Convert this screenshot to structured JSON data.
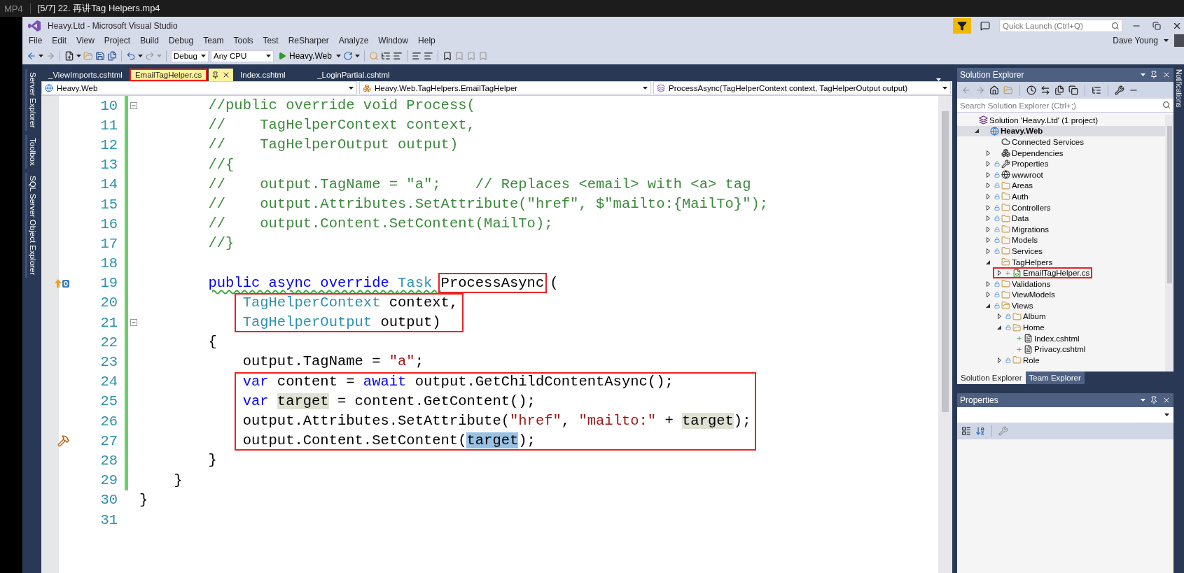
{
  "player": {
    "format": "MP4",
    "title": "[5/7] 22. 再讲Tag Helpers.mp4"
  },
  "window": {
    "title": "Heavy.Ltd - Microsoft Visual Studio",
    "quick_launch": {
      "placeholder": "Quick Launch (Ctrl+Q)"
    },
    "user": "Dave Young"
  },
  "menu": [
    "File",
    "Edit",
    "View",
    "Project",
    "Build",
    "Debug",
    "Team",
    "Tools",
    "Test",
    "ReSharper",
    "Analyze",
    "Window",
    "Help"
  ],
  "toolbar": {
    "configuration": "Debug",
    "platform": "Any CPU",
    "run": "Heavy.Web"
  },
  "left_tool_tabs": [
    "Server Explorer",
    "Toolbox",
    "SQL Server Object Explorer"
  ],
  "right_tool_tabs": [
    "Notifications"
  ],
  "editor": {
    "tabs": [
      {
        "label": "_ViewImports.cshtml",
        "selected": false,
        "boxed": false
      },
      {
        "label": "EmailTagHelper.cs",
        "selected": true,
        "boxed": true
      },
      {
        "label": "Index.cshtml",
        "selected": false,
        "boxed": false
      },
      {
        "label": "_LoginPartial.cshtml",
        "selected": false,
        "boxed": false
      }
    ],
    "navigation": [
      "Heavy.Web",
      "Heavy.Web.TagHelpers.EmailTagHelper",
      "ProcessAsync(TagHelperContext context, TagHelperOutput output)"
    ],
    "lines": [
      {
        "number": "10",
        "changed": true,
        "foldable": true,
        "tokens": [
          {
            "kind": "comment",
            "text": "        //public override void Process("
          }
        ]
      },
      {
        "number": "11",
        "changed": true,
        "tokens": [
          {
            "kind": "comment",
            "text": "        //    TagHelperContext context,"
          }
        ]
      },
      {
        "number": "12",
        "changed": true,
        "tokens": [
          {
            "kind": "comment",
            "text": "        //    TagHelperOutput output)"
          }
        ]
      },
      {
        "number": "13",
        "changed": true,
        "tokens": [
          {
            "kind": "comment",
            "text": "        //{"
          }
        ]
      },
      {
        "number": "14",
        "changed": true,
        "tokens": [
          {
            "kind": "comment",
            "text": "        //    output.TagName = \"a\";    // Replaces <email> with <a> tag"
          }
        ]
      },
      {
        "number": "15",
        "changed": true,
        "tokens": [
          {
            "kind": "comment",
            "text": "        //    output.Attributes.SetAttribute(\"href\", $\"mailto:{MailTo}\");"
          }
        ]
      },
      {
        "number": "16",
        "changed": true,
        "tokens": [
          {
            "kind": "comment",
            "text": "        //    output.Content.SetContent(MailTo);"
          }
        ]
      },
      {
        "number": "17",
        "changed": true,
        "tokens": [
          {
            "kind": "comment",
            "text": "        //}"
          }
        ]
      },
      {
        "number": "18",
        "changed": true
      },
      {
        "number": "19",
        "changed": true,
        "override_glyph": true,
        "tokens": [
          {
            "kind": "keyword",
            "text": "        public async override ",
            "warning": true
          },
          {
            "kind": "type",
            "text": "Task ",
            "warning": true
          },
          {
            "kind": "plain",
            "text": "ProcessAsync",
            "boxed": true
          },
          {
            "kind": "plain",
            "text": "("
          }
        ]
      },
      {
        "number": "20",
        "changed": true,
        "boxed": true,
        "tokens": [
          {
            "kind": "type",
            "text": "            TagHelperContext"
          },
          {
            "kind": "plain",
            "text": " context,"
          }
        ]
      },
      {
        "number": "21",
        "changed": true,
        "boxed": true,
        "foldable": true,
        "tokens": [
          {
            "kind": "type",
            "text": "            TagHelperOutput"
          },
          {
            "kind": "plain",
            "text": " output)"
          }
        ]
      },
      {
        "number": "22",
        "changed": true,
        "tokens": [
          {
            "kind": "plain",
            "text": "        {"
          }
        ]
      },
      {
        "number": "23",
        "changed": true,
        "tokens": [
          {
            "kind": "plain",
            "text": "            output.TagName = "
          },
          {
            "kind": "string",
            "text": "\"a\""
          },
          {
            "kind": "plain",
            "text": ";"
          }
        ]
      },
      {
        "number": "24",
        "changed": true,
        "boxed": true,
        "tokens": [
          {
            "kind": "keyword",
            "text": "            var"
          },
          {
            "kind": "plain",
            "text": " content = "
          },
          {
            "kind": "keyword",
            "text": "await"
          },
          {
            "kind": "plain",
            "text": " output.GetChildContentAsync();"
          }
        ]
      },
      {
        "number": "25",
        "changed": true,
        "boxed": true,
        "tokens": [
          {
            "kind": "keyword",
            "text": "            var "
          },
          {
            "kind": "reference",
            "text": "target"
          },
          {
            "kind": "plain",
            "text": " = content.GetContent();"
          }
        ]
      },
      {
        "number": "26",
        "changed": true,
        "boxed": true,
        "tokens": [
          {
            "kind": "plain",
            "text": "            output.Attributes.SetAttribute("
          },
          {
            "kind": "string",
            "text": "\"href\""
          },
          {
            "kind": "plain",
            "text": ", "
          },
          {
            "kind": "string",
            "text": "\"mailto:\""
          },
          {
            "kind": "plain",
            "text": " + "
          },
          {
            "kind": "reference",
            "text": "target"
          },
          {
            "kind": "plain",
            "text": ");"
          }
        ]
      },
      {
        "number": "27",
        "changed": true,
        "boxed": true,
        "build_glyph": true,
        "tokens": [
          {
            "kind": "plain",
            "text": "            output.Content.SetContent("
          },
          {
            "kind": "selection",
            "text": "target"
          },
          {
            "kind": "plain",
            "text": ");"
          }
        ]
      },
      {
        "number": "28",
        "changed": true,
        "tokens": [
          {
            "kind": "plain",
            "text": "        }"
          }
        ]
      },
      {
        "number": "29",
        "changed": true,
        "tokens": [
          {
            "kind": "plain",
            "text": "    }"
          }
        ]
      },
      {
        "number": "30",
        "changed": false,
        "tokens": [
          {
            "kind": "plain",
            "text": "}"
          }
        ]
      },
      {
        "number": "31",
        "changed": false
      }
    ]
  },
  "solution_explorer": {
    "title": "Solution Explorer",
    "search": {
      "placeholder": "Search Solution Explorer (Ctrl+;)"
    },
    "tree": [
      {
        "label": "Solution 'Heavy.Ltd' (1 project)",
        "kind": "solution",
        "checked_in": false,
        "added": false,
        "selected": false,
        "children": [
          {
            "label": "Heavy.Web",
            "kind": "project",
            "checked_in": false,
            "added": false,
            "selected": true,
            "expanded": true,
            "children": [
              {
                "label": "Connected Services",
                "kind": "cloud",
                "checked_in": false,
                "added": false,
                "selected": false
              },
              {
                "label": "Dependencies",
                "kind": "dependencies",
                "checked_in": false,
                "added": false,
                "selected": false,
                "expanded": false
              },
              {
                "label": "Properties",
                "kind": "properties",
                "checked_in": true,
                "added": false,
                "selected": false,
                "expanded": false
              },
              {
                "label": "wwwroot",
                "kind": "globe",
                "checked_in": true,
                "added": false,
                "selected": false,
                "expanded": false
              },
              {
                "label": "Areas",
                "kind": "folder",
                "checked_in": true,
                "added": false,
                "selected": false,
                "expanded": false
              },
              {
                "label": "Auth",
                "kind": "folder",
                "checked_in": true,
                "added": false,
                "selected": false,
                "expanded": false
              },
              {
                "label": "Controllers",
                "kind": "folder",
                "checked_in": true,
                "added": false,
                "selected": false,
                "expanded": false
              },
              {
                "label": "Data",
                "kind": "folder",
                "checked_in": true,
                "added": false,
                "selected": false,
                "expanded": false
              },
              {
                "label": "Migrations",
                "kind": "folder",
                "checked_in": true,
                "added": false,
                "selected": false,
                "expanded": false
              },
              {
                "label": "Models",
                "kind": "folder",
                "checked_in": true,
                "added": false,
                "selected": false,
                "expanded": false
              },
              {
                "label": "Services",
                "kind": "folder",
                "checked_in": true,
                "added": false,
                "selected": false,
                "expanded": false
              },
              {
                "label": "TagHelpers",
                "kind": "folder",
                "checked_in": false,
                "added": false,
                "selected": false,
                "expanded": true,
                "children": [
                  {
                    "label": "EmailTagHelper.cs",
                    "kind": "csharp",
                    "checked_in": false,
                    "added": true,
                    "selected": false,
                    "expanded": false,
                    "boxed": true
                  }
                ]
              },
              {
                "label": "Validations",
                "kind": "folder",
                "checked_in": true,
                "added": false,
                "selected": false,
                "expanded": false
              },
              {
                "label": "ViewModels",
                "kind": "folder",
                "checked_in": true,
                "added": false,
                "selected": false,
                "expanded": false
              },
              {
                "label": "Views",
                "kind": "folder",
                "checked_in": true,
                "added": false,
                "selected": false,
                "expanded": true,
                "children": [
                  {
                    "label": "Album",
                    "kind": "folder",
                    "checked_in": true,
                    "added": false,
                    "selected": false,
                    "expanded": false
                  },
                  {
                    "label": "Home",
                    "kind": "folder",
                    "checked_in": true,
                    "added": false,
                    "selected": false,
                    "expanded": true,
                    "children": [
                      {
                        "label": "Index.cshtml",
                        "kind": "razor",
                        "checked_in": false,
                        "added": true,
                        "selected": false
                      },
                      {
                        "label": "Privacy.cshtml",
                        "kind": "razor",
                        "checked_in": false,
                        "added": true,
                        "selected": false
                      }
                    ]
                  },
                  {
                    "label": "Role",
                    "kind": "folder",
                    "checked_in": true,
                    "added": false,
                    "selected": false,
                    "expanded": false
                  }
                ]
              }
            ]
          }
        ]
      }
    ],
    "tabs": [
      {
        "label": "Solution Explorer",
        "selected": true
      },
      {
        "label": "Team Explorer",
        "selected": false
      }
    ]
  },
  "properties": {
    "title": "Properties"
  }
}
